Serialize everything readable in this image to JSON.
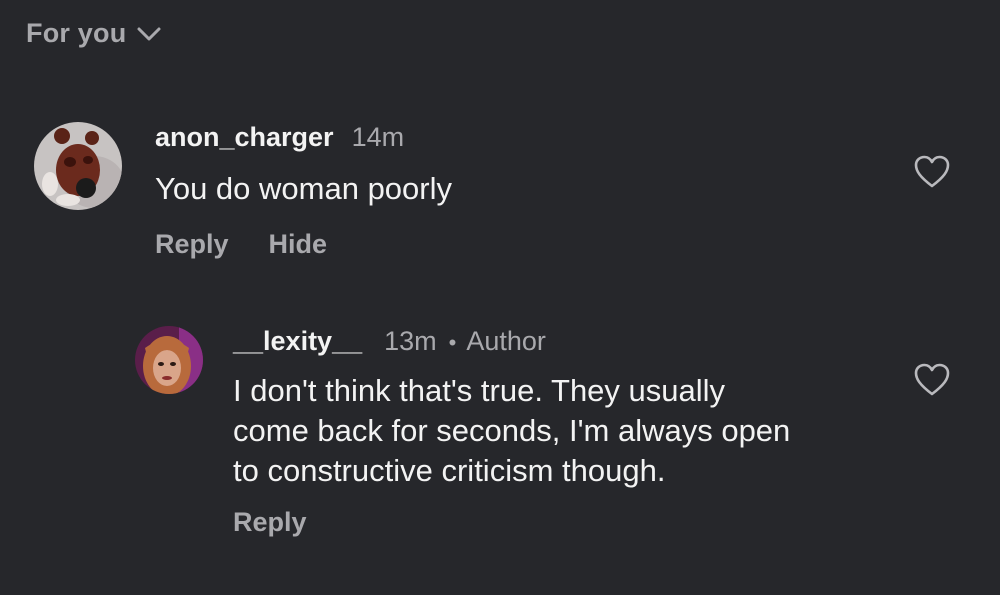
{
  "header": {
    "filter_label": "For you",
    "filter_icon": "chevron-down-icon"
  },
  "comments": [
    {
      "username": "anon_charger",
      "time": "14m",
      "text": "You do woman poorly",
      "actions": {
        "reply": "Reply",
        "hide": "Hide"
      },
      "like_icon": "heart-outline-icon"
    }
  ],
  "replies": [
    {
      "username": "__lexity__",
      "time": "13m",
      "separator": "•",
      "badge": "Author",
      "text_lines": [
        "I don't think that's true. They usually",
        "come back for seconds, I'm always open",
        "to constructive criticism though."
      ],
      "actions": {
        "reply": "Reply"
      },
      "like_icon": "heart-outline-icon"
    }
  ],
  "colors": {
    "background": "#26272b",
    "primary_text": "#f3f3f3",
    "secondary_text": "#a9a9ad"
  }
}
